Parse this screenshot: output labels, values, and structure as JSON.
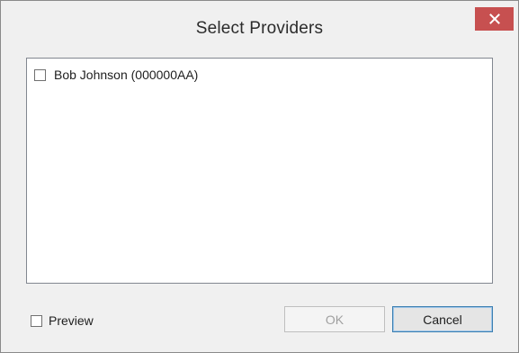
{
  "window": {
    "title": "Select Providers",
    "close_icon": "close-icon",
    "close_color": "#c75050"
  },
  "providers": {
    "items": [
      {
        "label": "Bob Johnson (000000AA)",
        "checked": false
      }
    ]
  },
  "footer": {
    "preview_label": "Preview",
    "preview_checked": false,
    "ok_label": "OK",
    "ok_enabled": false,
    "cancel_label": "Cancel"
  }
}
